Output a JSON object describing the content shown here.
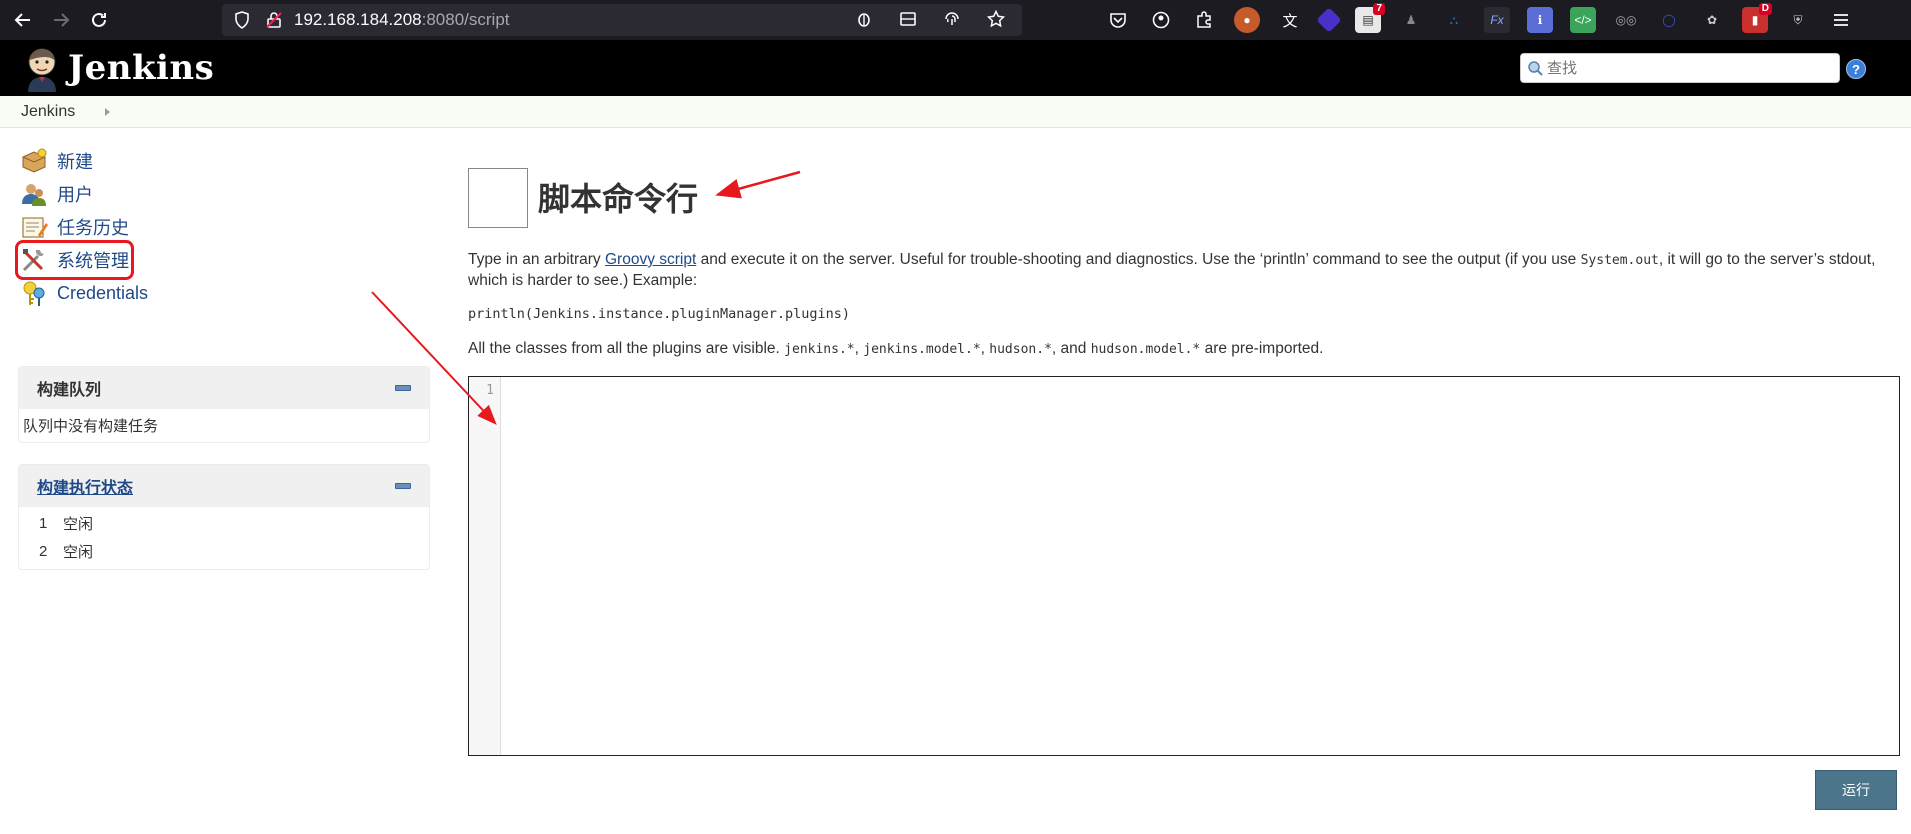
{
  "browser": {
    "url_host": "192.168.184.208",
    "url_rest": ":8080/script",
    "extension_badges": {
      "ext4": "7",
      "ext15": "D"
    }
  },
  "header": {
    "title": "Jenkins",
    "search_placeholder": "查找",
    "help_label": "?"
  },
  "breadcrumb": {
    "items": [
      "Jenkins"
    ]
  },
  "sidebar": {
    "tasks": [
      {
        "label": "新建",
        "icon": "new-item-icon"
      },
      {
        "label": "用户",
        "icon": "users-icon"
      },
      {
        "label": "任务历史",
        "icon": "build-history-icon"
      },
      {
        "label": "系统管理",
        "icon": "manage-jenkins-icon"
      },
      {
        "label": "Credentials",
        "icon": "credentials-icon"
      }
    ],
    "build_queue": {
      "title": "构建队列",
      "empty_text": "队列中没有构建任务"
    },
    "executors": {
      "title": "构建执行状态",
      "rows": [
        {
          "num": "1",
          "status": "空闲"
        },
        {
          "num": "2",
          "status": "空闲"
        }
      ]
    }
  },
  "main": {
    "title": "脚本命令行",
    "desc_1": "Type in an arbitrary ",
    "desc_link": "Groovy script",
    "desc_2": " and execute it on the server. Useful for trouble-shooting and diagnostics. Use the ‘println’ command to see the output (if you use ",
    "desc_code": "System.out",
    "desc_3": ", it will go to the server’s stdout, which is harder to see.) Example:",
    "example": "println(Jenkins.instance.pluginManager.plugins)",
    "imports_1": "All the classes from all the plugins are visible. ",
    "imports_code_1": "jenkins.*",
    "imports_sep_1": ", ",
    "imports_code_2": "jenkins.model.*",
    "imports_sep_2": ", ",
    "imports_code_3": "hudson.*",
    "imports_sep_3": ", and ",
    "imports_code_4": "hudson.model.*",
    "imports_2": " are pre-imported.",
    "editor_line": "1",
    "run_label": "运行"
  },
  "colors": {
    "link": "#204a87",
    "annotation_red": "#e8181f",
    "run_button": "#4b758b"
  }
}
